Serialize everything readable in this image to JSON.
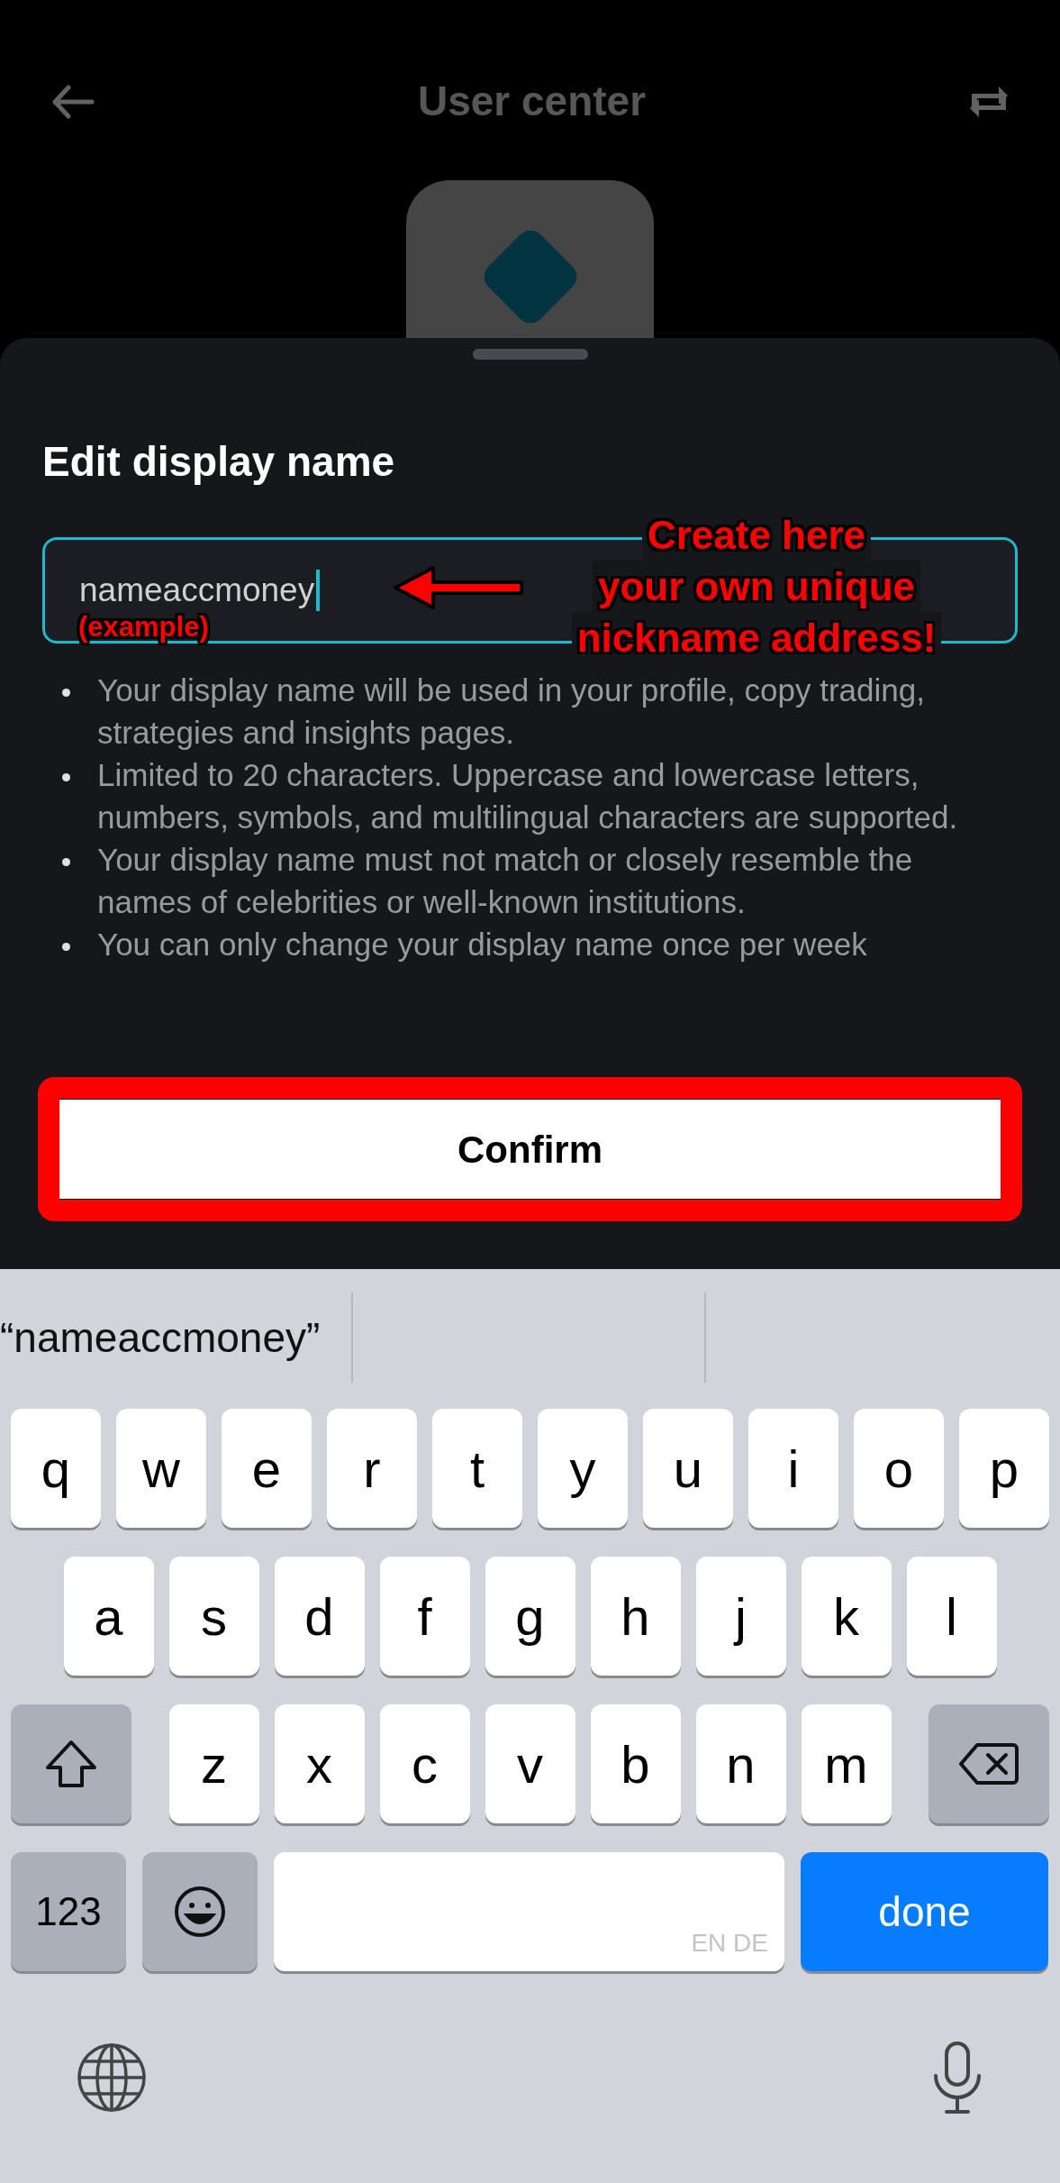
{
  "header": {
    "title": "User center"
  },
  "sheet": {
    "title": "Edit display name",
    "input": {
      "value": "nameaccmoney",
      "focused": true
    },
    "notes": [
      "Your display name will be used in your profile, copy trading, strategies and insights pages.",
      "Limited to 20 characters. Uppercase and lowercase letters, numbers, symbols, and multilingual characters are supported.",
      "Your display name must not match or closely resemble the names of celebrities or well-known institutions.",
      "You can only change your display name once per week"
    ],
    "confirm_button": "Confirm"
  },
  "annotations": {
    "callout": [
      "Create here",
      "your own unique",
      "nickname address!"
    ],
    "example_label": "(example)"
  },
  "keyboard": {
    "suggestions": [
      "“nameaccmoney”"
    ],
    "rows": [
      {
        "keys": [
          {
            "kind": "letter",
            "label": "q"
          },
          {
            "kind": "letter",
            "label": "w"
          },
          {
            "kind": "letter",
            "label": "e"
          },
          {
            "kind": "letter",
            "label": "r"
          },
          {
            "kind": "letter",
            "label": "t"
          },
          {
            "kind": "letter",
            "label": "y"
          },
          {
            "kind": "letter",
            "label": "u"
          },
          {
            "kind": "letter",
            "label": "i"
          },
          {
            "kind": "letter",
            "label": "o"
          },
          {
            "kind": "letter",
            "label": "p"
          }
        ]
      },
      {
        "keys": [
          {
            "kind": "letter",
            "label": "a"
          },
          {
            "kind": "letter",
            "label": "s"
          },
          {
            "kind": "letter",
            "label": "d"
          },
          {
            "kind": "letter",
            "label": "f"
          },
          {
            "kind": "letter",
            "label": "g"
          },
          {
            "kind": "letter",
            "label": "h"
          },
          {
            "kind": "letter",
            "label": "j"
          },
          {
            "kind": "letter",
            "label": "k"
          },
          {
            "kind": "letter",
            "label": "l"
          }
        ]
      },
      {
        "keys": [
          {
            "kind": "shift"
          },
          {
            "kind": "letter",
            "label": "z"
          },
          {
            "kind": "letter",
            "label": "x"
          },
          {
            "kind": "letter",
            "label": "c"
          },
          {
            "kind": "letter",
            "label": "v"
          },
          {
            "kind": "letter",
            "label": "b"
          },
          {
            "kind": "letter",
            "label": "n"
          },
          {
            "kind": "letter",
            "label": "m"
          },
          {
            "kind": "delete"
          }
        ]
      },
      {
        "keys": [
          {
            "kind": "numbers",
            "label": "123"
          },
          {
            "kind": "emoji"
          },
          {
            "kind": "space",
            "label": "EN DE"
          },
          {
            "kind": "done",
            "label": "done"
          }
        ]
      }
    ]
  }
}
